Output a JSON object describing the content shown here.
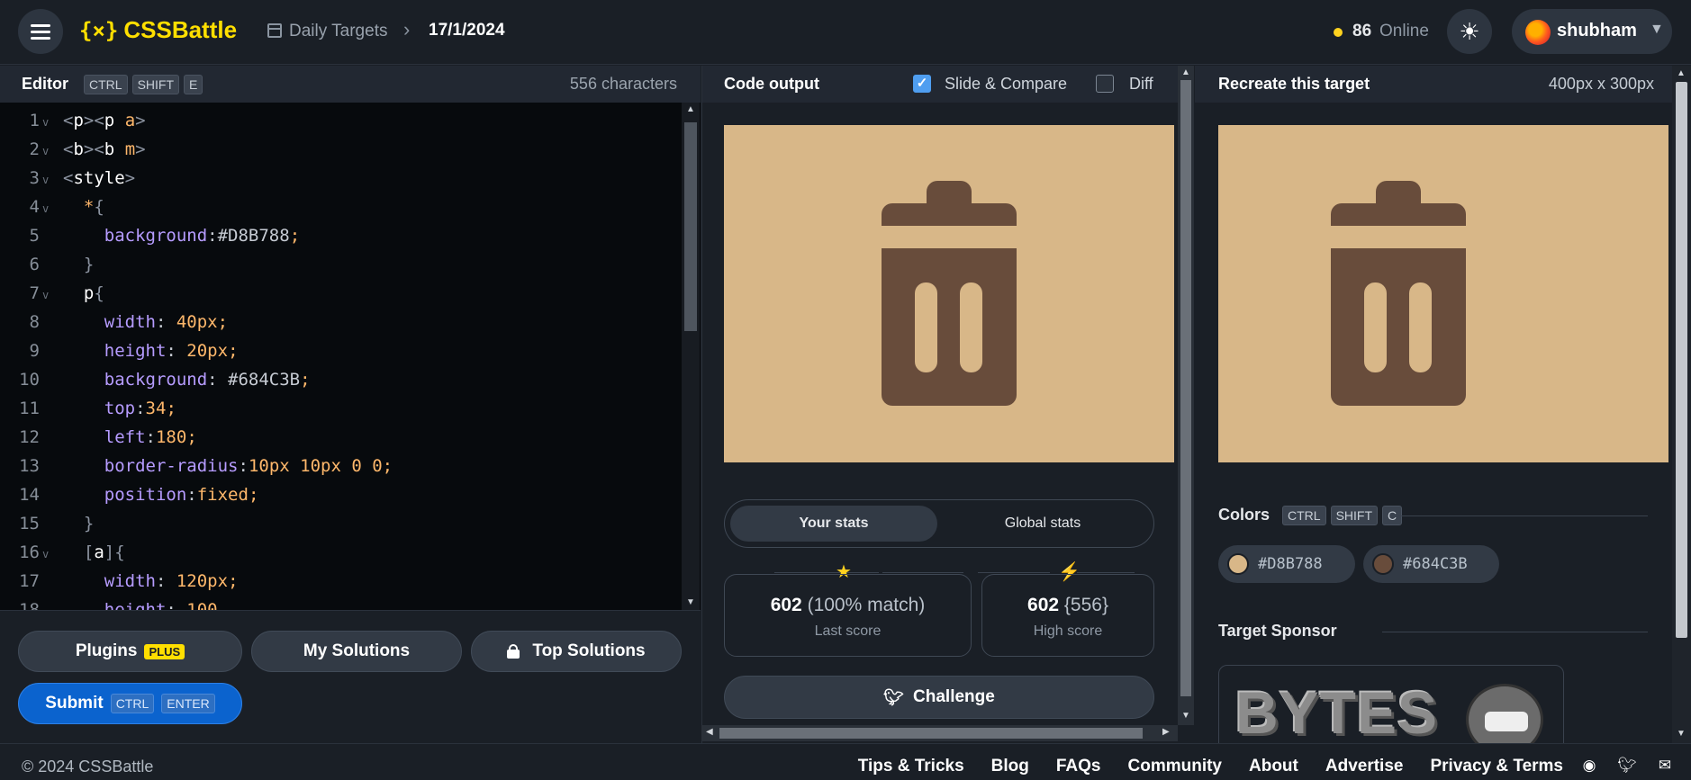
{
  "header": {
    "logo_mark": "{⨯}",
    "logo_text": "CSSBattle",
    "breadcrumb_section": "Daily Targets",
    "breadcrumb_separator": ">",
    "breadcrumb_date": "17/1/2024",
    "online_count": "86",
    "online_label": "Online",
    "theme_icon": "sun-icon",
    "user_name": "shubham"
  },
  "editor": {
    "title": "Editor",
    "shortcut_keys": [
      "CTRL",
      "SHIFT",
      "E"
    ],
    "char_count": "556 characters",
    "lines": [
      {
        "n": "1",
        "fold": true,
        "code": [
          {
            "t": "<",
            "c": "br"
          },
          {
            "t": "p",
            "c": "tag"
          },
          {
            "t": "><",
            "c": "br"
          },
          {
            "t": "p ",
            "c": "tag"
          },
          {
            "t": "a",
            "c": "attr"
          },
          {
            "t": ">",
            "c": "br"
          }
        ]
      },
      {
        "n": "2",
        "fold": true,
        "code": [
          {
            "t": "<",
            "c": "br"
          },
          {
            "t": "b",
            "c": "tag"
          },
          {
            "t": "><",
            "c": "br"
          },
          {
            "t": "b ",
            "c": "tag"
          },
          {
            "t": "m",
            "c": "attr"
          },
          {
            "t": ">",
            "c": "br"
          }
        ]
      },
      {
        "n": "3",
        "fold": true,
        "code": [
          {
            "t": "<",
            "c": "br"
          },
          {
            "t": "style",
            "c": "tag"
          },
          {
            "t": ">",
            "c": "br"
          }
        ]
      },
      {
        "n": "4",
        "fold": true,
        "code": [
          {
            "t": "  ",
            "c": "plain"
          },
          {
            "t": "*",
            "c": "sel"
          },
          {
            "t": "{",
            "c": "br"
          }
        ]
      },
      {
        "n": "5",
        "fold": false,
        "code": [
          {
            "t": "    ",
            "c": "plain"
          },
          {
            "t": "background",
            "c": "prop"
          },
          {
            "t": ":",
            "c": "plain"
          },
          {
            "t": "#D8B788",
            "c": "hex"
          },
          {
            "t": ";",
            "c": "val"
          }
        ]
      },
      {
        "n": "6",
        "fold": false,
        "code": [
          {
            "t": "  ",
            "c": "plain"
          },
          {
            "t": "}",
            "c": "br"
          }
        ]
      },
      {
        "n": "7",
        "fold": true,
        "code": [
          {
            "t": "  ",
            "c": "plain"
          },
          {
            "t": "p",
            "c": "tag"
          },
          {
            "t": "{",
            "c": "br"
          }
        ]
      },
      {
        "n": "8",
        "fold": false,
        "code": [
          {
            "t": "    ",
            "c": "plain"
          },
          {
            "t": "width",
            "c": "prop"
          },
          {
            "t": ": ",
            "c": "plain"
          },
          {
            "t": "40px",
            "c": "num"
          },
          {
            "t": ";",
            "c": "val"
          }
        ]
      },
      {
        "n": "9",
        "fold": false,
        "code": [
          {
            "t": "    ",
            "c": "plain"
          },
          {
            "t": "height",
            "c": "prop"
          },
          {
            "t": ": ",
            "c": "plain"
          },
          {
            "t": "20px",
            "c": "num"
          },
          {
            "t": ";",
            "c": "val"
          }
        ]
      },
      {
        "n": "10",
        "fold": false,
        "code": [
          {
            "t": "    ",
            "c": "plain"
          },
          {
            "t": "background",
            "c": "prop"
          },
          {
            "t": ": ",
            "c": "plain"
          },
          {
            "t": "#684C3B",
            "c": "hex"
          },
          {
            "t": ";",
            "c": "val"
          }
        ]
      },
      {
        "n": "11",
        "fold": false,
        "code": [
          {
            "t": "    ",
            "c": "plain"
          },
          {
            "t": "top",
            "c": "prop"
          },
          {
            "t": ":",
            "c": "plain"
          },
          {
            "t": "34",
            "c": "num"
          },
          {
            "t": ";",
            "c": "val"
          }
        ]
      },
      {
        "n": "12",
        "fold": false,
        "code": [
          {
            "t": "    ",
            "c": "plain"
          },
          {
            "t": "left",
            "c": "prop"
          },
          {
            "t": ":",
            "c": "plain"
          },
          {
            "t": "180",
            "c": "num"
          },
          {
            "t": ";",
            "c": "val"
          }
        ]
      },
      {
        "n": "13",
        "fold": false,
        "code": [
          {
            "t": "    ",
            "c": "plain"
          },
          {
            "t": "border-radius",
            "c": "prop"
          },
          {
            "t": ":",
            "c": "plain"
          },
          {
            "t": "10px 10px 0 0",
            "c": "num"
          },
          {
            "t": ";",
            "c": "val"
          }
        ]
      },
      {
        "n": "14",
        "fold": false,
        "code": [
          {
            "t": "    ",
            "c": "plain"
          },
          {
            "t": "position",
            "c": "prop"
          },
          {
            "t": ":",
            "c": "plain"
          },
          {
            "t": "fixed",
            "c": "val"
          },
          {
            "t": ";",
            "c": "val"
          }
        ]
      },
      {
        "n": "15",
        "fold": false,
        "code": [
          {
            "t": "  ",
            "c": "plain"
          },
          {
            "t": "}",
            "c": "br"
          }
        ]
      },
      {
        "n": "16",
        "fold": true,
        "code": [
          {
            "t": "  ",
            "c": "plain"
          },
          {
            "t": "[",
            "c": "br"
          },
          {
            "t": "a",
            "c": "tag"
          },
          {
            "t": "]{",
            "c": "br"
          }
        ]
      },
      {
        "n": "17",
        "fold": false,
        "code": [
          {
            "t": "    ",
            "c": "plain"
          },
          {
            "t": "width",
            "c": "prop"
          },
          {
            "t": ": ",
            "c": "plain"
          },
          {
            "t": "120px",
            "c": "num"
          },
          {
            "t": ";",
            "c": "val"
          }
        ]
      },
      {
        "n": "18",
        "fold": false,
        "code": [
          {
            "t": "    ",
            "c": "plain"
          },
          {
            "t": "height",
            "c": "prop"
          },
          {
            "t": ": ",
            "c": "plain"
          },
          {
            "t": "100",
            "c": "num"
          }
        ]
      }
    ],
    "buttons": {
      "plugins": "Plugins",
      "plugins_badge": "PLUS",
      "my_solutions": "My Solutions",
      "top_solutions": "Top Solutions",
      "submit": "Submit",
      "submit_keys": [
        "CTRL",
        "ENTER"
      ]
    }
  },
  "output": {
    "title": "Code output",
    "slide_compare_label": "Slide & Compare",
    "slide_compare_checked": true,
    "diff_label": "Diff",
    "diff_checked": false,
    "tabs": [
      "Your stats",
      "Global stats"
    ],
    "active_tab": "Your stats",
    "last_score_value": "602",
    "last_score_match": "(100% match)",
    "last_score_label": "Last score",
    "high_score_value": "602",
    "high_score_chars": "{556}",
    "high_score_label": "High score",
    "challenge_label": "Challenge"
  },
  "target": {
    "title": "Recreate this target",
    "size": "400px x 300px",
    "colors_title": "Colors",
    "colors_keys": [
      "CTRL",
      "SHIFT",
      "C"
    ],
    "colors": [
      {
        "hex": "#D8B788",
        "label": "#D8B788"
      },
      {
        "hex": "#684C3B",
        "label": "#684C3B"
      }
    ],
    "sponsor_title": "Target Sponsor",
    "sponsor_name": "BYTES"
  },
  "footer": {
    "copyright": "© 2024 CSSBattle",
    "links": [
      "Tips & Tricks",
      "Blog",
      "FAQs",
      "Community",
      "About",
      "Advertise",
      "Privacy & Terms"
    ],
    "icons": [
      "discord-icon",
      "twitter-icon",
      "mail-icon"
    ]
  }
}
